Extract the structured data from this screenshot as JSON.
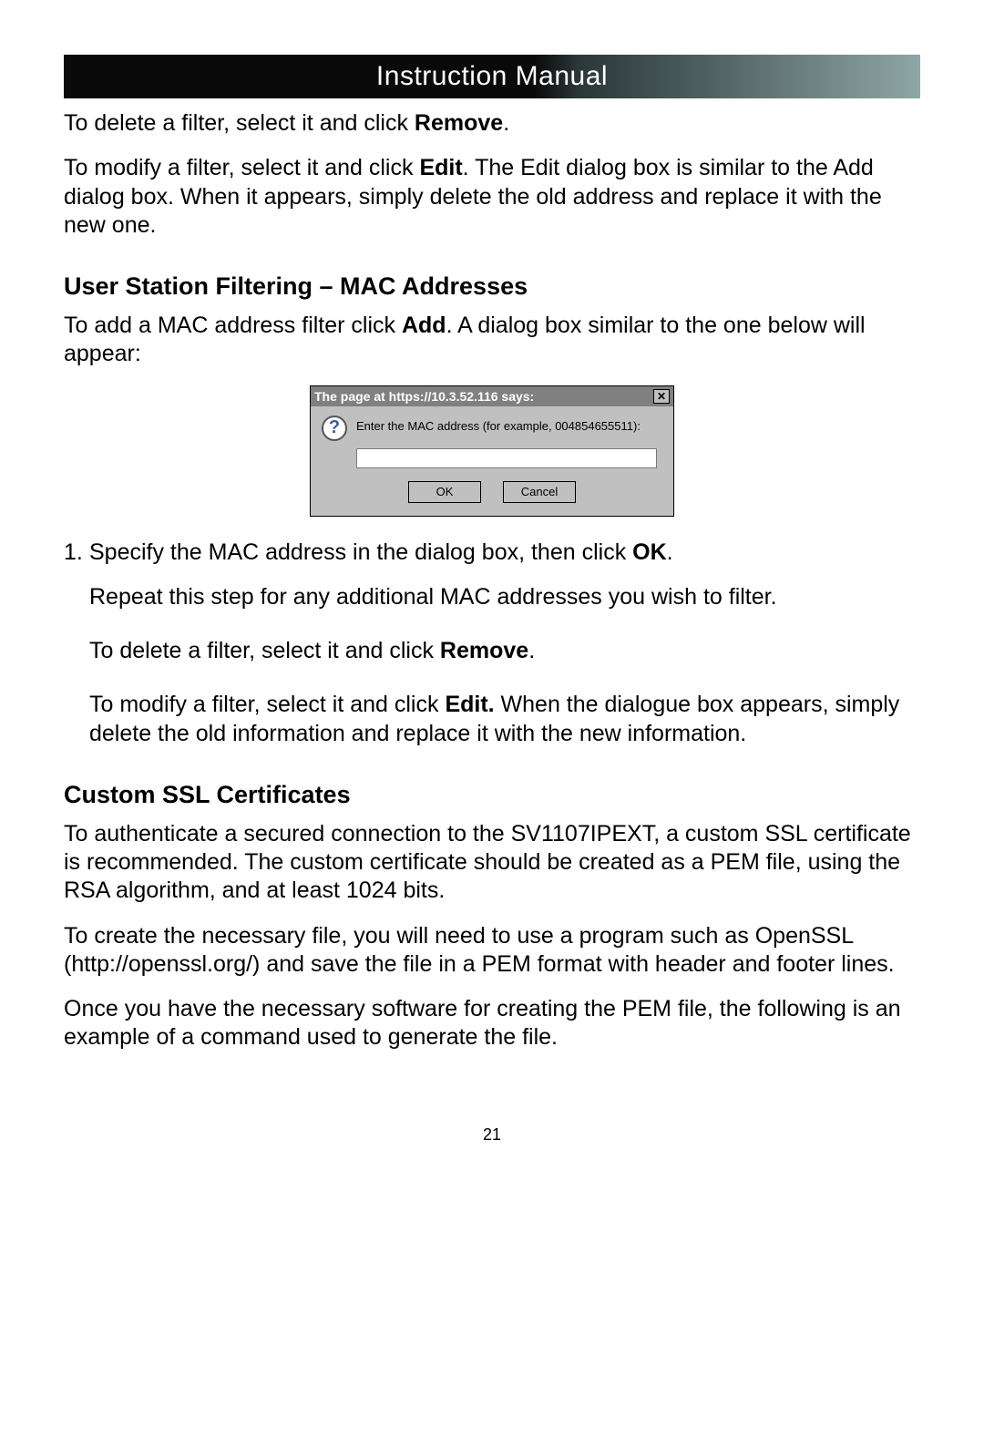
{
  "header": {
    "title": "Instruction Manual"
  },
  "intro": {
    "delete_pre": "To delete a filter, select it and click ",
    "delete_bold": "Remove",
    "delete_post": ".",
    "modify_pre": "To modify a filter, select it and click ",
    "modify_bold": "Edit",
    "modify_post": ". The Edit dialog box is similar to the Add dialog box.  When it appears, simply delete the old address and replace it with the new one."
  },
  "section1": {
    "heading": "User Station Filtering – MAC Addresses",
    "p1_pre": "To add a MAC address filter click ",
    "p1_bold": "Add",
    "p1_post": ". A dialog box similar to the one below will appear:"
  },
  "dialog": {
    "title": "The page at https://10.3.52.116 says:",
    "prompt": "Enter the MAC address (for example, 004854655511):",
    "ok": "OK",
    "cancel": "Cancel",
    "close_glyph": "✕"
  },
  "steps": {
    "s1_num": "1.",
    "s1_pre": "Specify the MAC address in the dialog box, then click ",
    "s1_bold": "OK",
    "s1_post": ".",
    "s1_repeat": "Repeat this step for any additional MAC addresses you wish to filter.",
    "del_pre": "To delete a filter, select it and click ",
    "del_bold": "Remove",
    "del_post": ".",
    "mod_pre": "To modify a filter, select it and click ",
    "mod_bold": "Edit.",
    "mod_post": " When the dialogue box appears, simply delete the old information and replace it with the new information."
  },
  "section2": {
    "heading": "Custom SSL Certificates",
    "p1": "To authenticate a secured connection to the SV1107IPEXT, a custom SSL certificate is recommended. The custom certificate should be created as a PEM file, using the RSA algorithm, and at least 1024 bits.",
    "p2": "To create the necessary file, you will need to use a program such as OpenSSL (http://openssl.org/) and save the file in a PEM format with header and footer lines.",
    "p3": "Once you have the necessary software for creating the PEM file, the following is an example of a command used to generate the file."
  },
  "page_number": "21"
}
